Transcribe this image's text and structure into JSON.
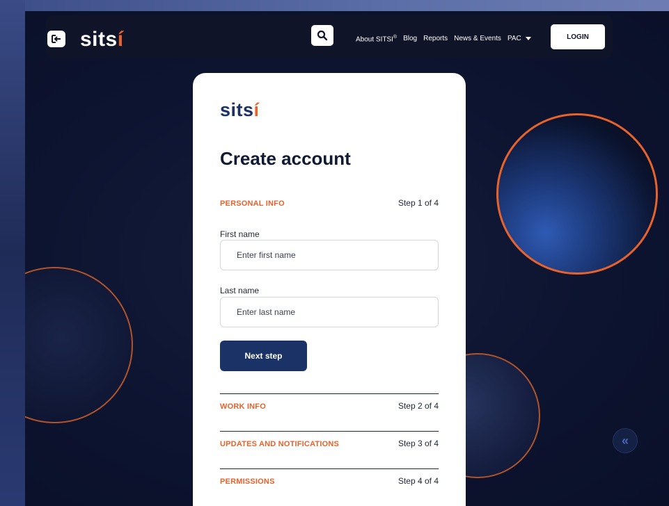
{
  "nav": {
    "logo_main": "sits",
    "logo_accent": "í",
    "links": [
      "About SITSI",
      "Blog",
      "Reports",
      "News & Events",
      "PAC"
    ],
    "about_superscript": "®",
    "login_label": "LOGIN"
  },
  "card": {
    "logo_main": "sits",
    "logo_accent": "í",
    "title": "Create account",
    "personal": {
      "name": "PERSONAL INFO",
      "step": "Step 1 of 4",
      "first_label": "First name",
      "first_placeholder": "Enter first name",
      "last_label": "Last name",
      "last_placeholder": "Enter last name",
      "next_label": "Next step"
    },
    "sections": [
      {
        "name": "WORK INFO",
        "step": "Step 2 of 4"
      },
      {
        "name": "UPDATES AND NOTIFICATIONS",
        "step": "Step 3 of 4"
      },
      {
        "name": "PERMISSIONS",
        "step": "Step 4 of 4"
      }
    ]
  },
  "colors": {
    "accent": "#e8622c",
    "brand": "#1a3266",
    "background": "#0d1430"
  },
  "icons": {
    "exit": "exit-icon",
    "search": "search-icon",
    "pac_dropdown": "caret-down-icon",
    "scroll": "double-chevron-left-icon"
  }
}
